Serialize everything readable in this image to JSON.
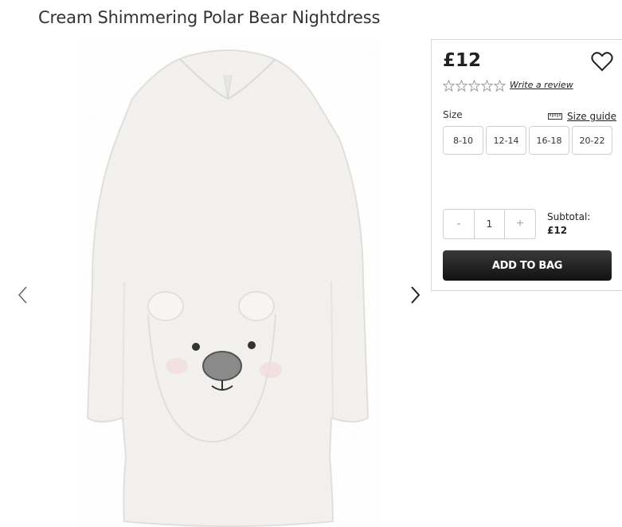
{
  "product": {
    "title": "Cream Shimmering Polar Bear Nightdress",
    "price": "£12",
    "review_link": "Write a review",
    "rating": 0,
    "rating_max": 5
  },
  "size": {
    "label": "Size",
    "guide_label": "Size guide",
    "options": [
      "8-10",
      "12-14",
      "16-18",
      "20-22"
    ]
  },
  "quantity": {
    "minus": "-",
    "value": "1",
    "plus": "+"
  },
  "subtotal": {
    "label": "Subtotal:",
    "value": "£12"
  },
  "actions": {
    "add_to_bag": "ADD TO BAG"
  },
  "icons": {
    "prev": "chevron-left-icon",
    "next": "chevron-right-icon",
    "wishlist": "heart-icon",
    "size_guide": "ruler-icon",
    "star": "star-outline-icon"
  }
}
